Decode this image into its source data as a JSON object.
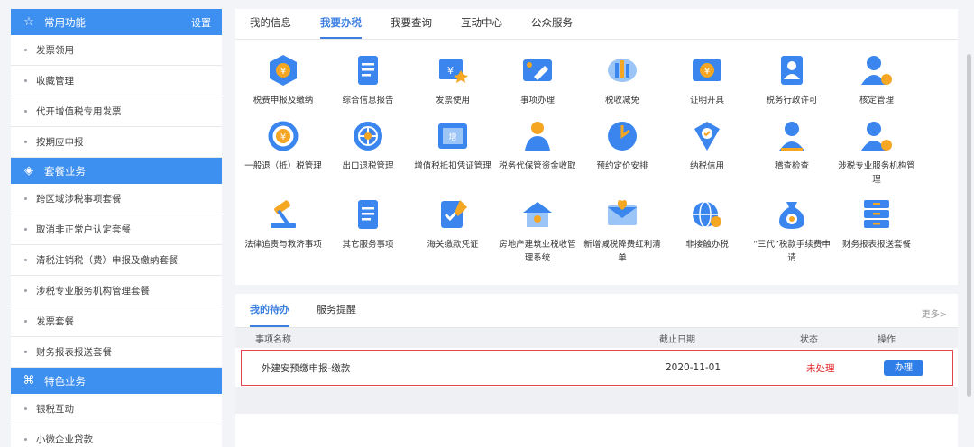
{
  "sidebar": {
    "common": {
      "title": "常用功能",
      "settings": "设置"
    },
    "common_items": [
      "发票领用",
      "收藏管理",
      "代开增值税专用发票",
      "按期应申报"
    ],
    "package": {
      "title": "套餐业务"
    },
    "package_items": [
      "跨区域涉税事项套餐",
      "取消非正常户认定套餐",
      "清税注销税（费）申报及缴纳套餐",
      "涉税专业服务机构管理套餐",
      "发票套餐",
      "财务报表报送套餐"
    ],
    "special": {
      "title": "特色业务"
    },
    "special_items": [
      "银税互动",
      "小微企业贷款"
    ]
  },
  "top_tabs": [
    "我的信息",
    "我要办税",
    "我要查询",
    "互动中心",
    "公众服务"
  ],
  "services": [
    {
      "label": "税费申报及缴纳",
      "icon": "tax-filing-icon"
    },
    {
      "label": "综合信息报告",
      "icon": "info-report-icon"
    },
    {
      "label": "发票使用",
      "icon": "invoice-use-icon"
    },
    {
      "label": "事项办理",
      "icon": "matter-handling-icon"
    },
    {
      "label": "税收减免",
      "icon": "tax-relief-icon"
    },
    {
      "label": "证明开具",
      "icon": "certificate-icon"
    },
    {
      "label": "税务行政许可",
      "icon": "admin-license-icon"
    },
    {
      "label": "核定管理",
      "icon": "verification-icon"
    },
    {
      "label": "一般退（抵）税管理",
      "icon": "tax-refund-icon"
    },
    {
      "label": "出口退税管理",
      "icon": "export-refund-icon"
    },
    {
      "label": "增值税抵扣凭证管理",
      "icon": "vat-deduction-icon"
    },
    {
      "label": "税务代保管资金收取",
      "icon": "fund-custody-icon"
    },
    {
      "label": "预约定价安排",
      "icon": "pricing-arrangement-icon"
    },
    {
      "label": "纳税信用",
      "icon": "tax-credit-icon"
    },
    {
      "label": "稽查检查",
      "icon": "inspection-icon"
    },
    {
      "label": "涉税专业服务机构管理",
      "icon": "professional-service-icon"
    },
    {
      "label": "法律追责与救济事项",
      "icon": "legal-remedy-icon"
    },
    {
      "label": "其它服务事项",
      "icon": "other-service-icon"
    },
    {
      "label": "海关缴款凭证",
      "icon": "customs-payment-icon"
    },
    {
      "label": "房地产建筑业税收管理系统",
      "icon": "real-estate-icon"
    },
    {
      "label": "新增减税降费红利清单",
      "icon": "tax-cut-list-icon"
    },
    {
      "label": "非接触办税",
      "icon": "contactless-icon"
    },
    {
      "label": "“三代”税款手续费申请",
      "icon": "commission-fee-icon"
    },
    {
      "label": "财务报表报送套餐",
      "icon": "financial-report-icon"
    }
  ],
  "todo": {
    "tabs": [
      "我的待办",
      "服务提醒"
    ],
    "more": "更多>",
    "columns": [
      "事项名称",
      "截止日期",
      "状态",
      "操作"
    ],
    "rows": [
      {
        "name": "外建安预缴申报-缴款",
        "deadline": "2020-11-01",
        "status": "未处理",
        "action": "办理"
      }
    ]
  },
  "colors": {
    "accent": "#3d8ff0",
    "icon_blue": "#3b86ee",
    "icon_orange": "#f5a623",
    "status_red": "#e02424"
  }
}
